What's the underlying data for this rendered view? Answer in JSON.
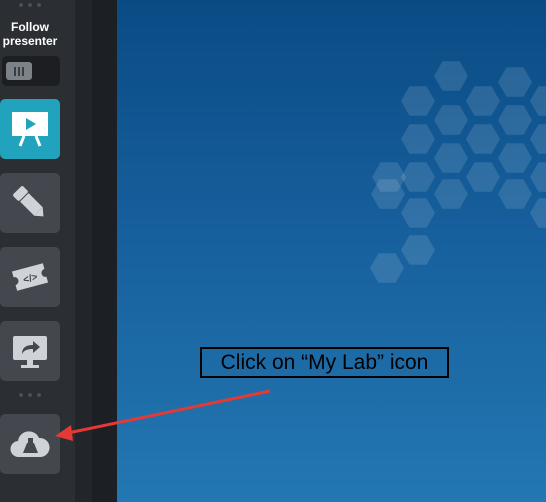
{
  "sidebar": {
    "follow_label": "Follow\npresenter",
    "toggle_state": "off",
    "tools": [
      {
        "name": "presentation-icon",
        "active": true
      },
      {
        "name": "pen-icon",
        "active": false
      },
      {
        "name": "code-ticket-icon",
        "active": false
      },
      {
        "name": "share-screen-icon",
        "active": false
      },
      {
        "name": "my-lab-icon",
        "active": false
      }
    ]
  },
  "annotation": {
    "callout_text": "Click on “My Lab” icon",
    "arrow_color": "#e53935"
  },
  "colors": {
    "active_accent": "#21a3bd",
    "sidebar_bg": "#2b2e33",
    "button_bg": "#44474d",
    "canvas_top": "#0a4b84",
    "canvas_bottom": "#2377b2"
  }
}
